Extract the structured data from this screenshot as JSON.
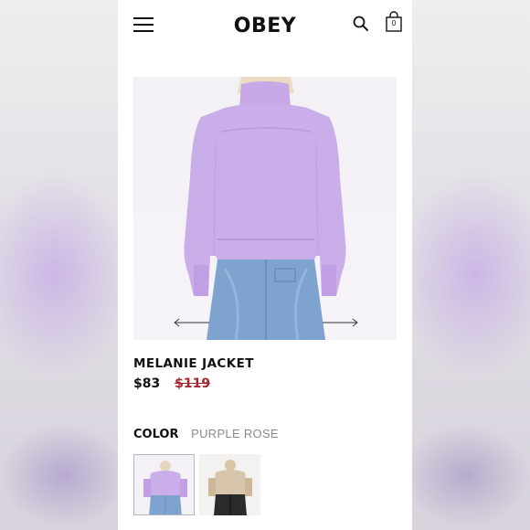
{
  "brand": {
    "logo": "OBEY"
  },
  "header": {
    "menu_icon": "hamburger-menu-icon",
    "search_icon": "search-icon",
    "bag_icon": "shopping-bag-icon",
    "bag_count": "0"
  },
  "product": {
    "name": "MELANIE JACKET",
    "sale_price": "$83",
    "original_price": "$119",
    "color_label": "COLOR",
    "color_value": "PURPLE ROSE",
    "image_colors": {
      "jacket": "#c9aee9",
      "jeans": "#7fa3cf"
    },
    "swatches": [
      {
        "color": "#c9aee9",
        "selected": true
      },
      {
        "color": "#d7c6ab",
        "selected": false
      }
    ]
  },
  "colors": {
    "sale_strike": "#a3252e",
    "muted_text": "#8a8a8a"
  }
}
